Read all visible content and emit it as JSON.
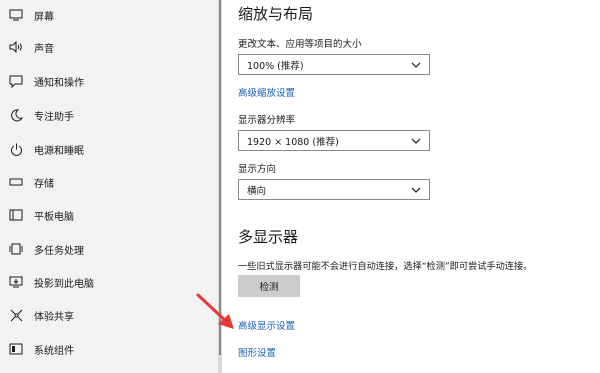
{
  "sidebar": {
    "items": [
      {
        "label": "屏幕",
        "icon": "display-icon"
      },
      {
        "label": "声音",
        "icon": "speaker-icon"
      },
      {
        "label": "通知和操作",
        "icon": "notification-icon"
      },
      {
        "label": "专注助手",
        "icon": "moon-icon"
      },
      {
        "label": "电源和睡眠",
        "icon": "power-icon"
      },
      {
        "label": "存储",
        "icon": "storage-icon"
      },
      {
        "label": "平板电脑",
        "icon": "tablet-icon"
      },
      {
        "label": "多任务处理",
        "icon": "multitask-icon"
      },
      {
        "label": "投影到此电脑",
        "icon": "project-icon"
      },
      {
        "label": "体验共享",
        "icon": "share-icon"
      },
      {
        "label": "系统组件",
        "icon": "components-icon"
      }
    ]
  },
  "scale": {
    "heading": "缩放与布局",
    "text_size_label": "更改文本、应用等项目的大小",
    "text_size_value": "100% (推荐)",
    "advanced_scaling_link": "高级缩放设置",
    "resolution_label": "显示器分辨率",
    "resolution_value": "1920 × 1080 (推荐)",
    "orientation_label": "显示方向",
    "orientation_value": "横向"
  },
  "multi": {
    "heading": "多显示器",
    "description": "一些旧式显示器可能不会进行自动连接，选择“检测”即可尝试手动连接。",
    "detect_button": "检测",
    "advanced_display_link": "高级显示设置",
    "graphics_link": "图形设置"
  },
  "colors": {
    "accent": "#1b5fb4",
    "annotation_arrow": "#e53935"
  }
}
